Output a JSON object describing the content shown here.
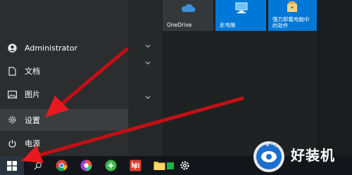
{
  "start_menu": {
    "nav_items": [
      {
        "label": "Administrator",
        "icon": "user-icon"
      },
      {
        "label": "文档",
        "icon": "document-icon"
      },
      {
        "label": "图片",
        "icon": "picture-icon"
      },
      {
        "label": "设置",
        "icon": "gear-icon"
      },
      {
        "label": "电源",
        "icon": "power-icon"
      }
    ]
  },
  "tiles": [
    {
      "label": "OneDrive",
      "icon": "cloud-icon"
    },
    {
      "label": "此电脑",
      "icon": "computer-icon"
    },
    {
      "label_line1": "强力卸载电脑中",
      "label_line2": "的软件",
      "icon": "package-icon"
    }
  ],
  "taskbar": {
    "icons": [
      "windows-start-icon",
      "search-icon",
      "chrome-icon",
      "colorful-browser-icon",
      "green-app-icon",
      "red-app-icon",
      "folder-icon",
      "green-square-icon",
      "settings-gear-icon"
    ]
  },
  "watermark": {
    "text": "好装机"
  },
  "colors": {
    "accent": "#0078d7",
    "arrow": "#e8191f",
    "highlight": "#3b3e3f"
  }
}
